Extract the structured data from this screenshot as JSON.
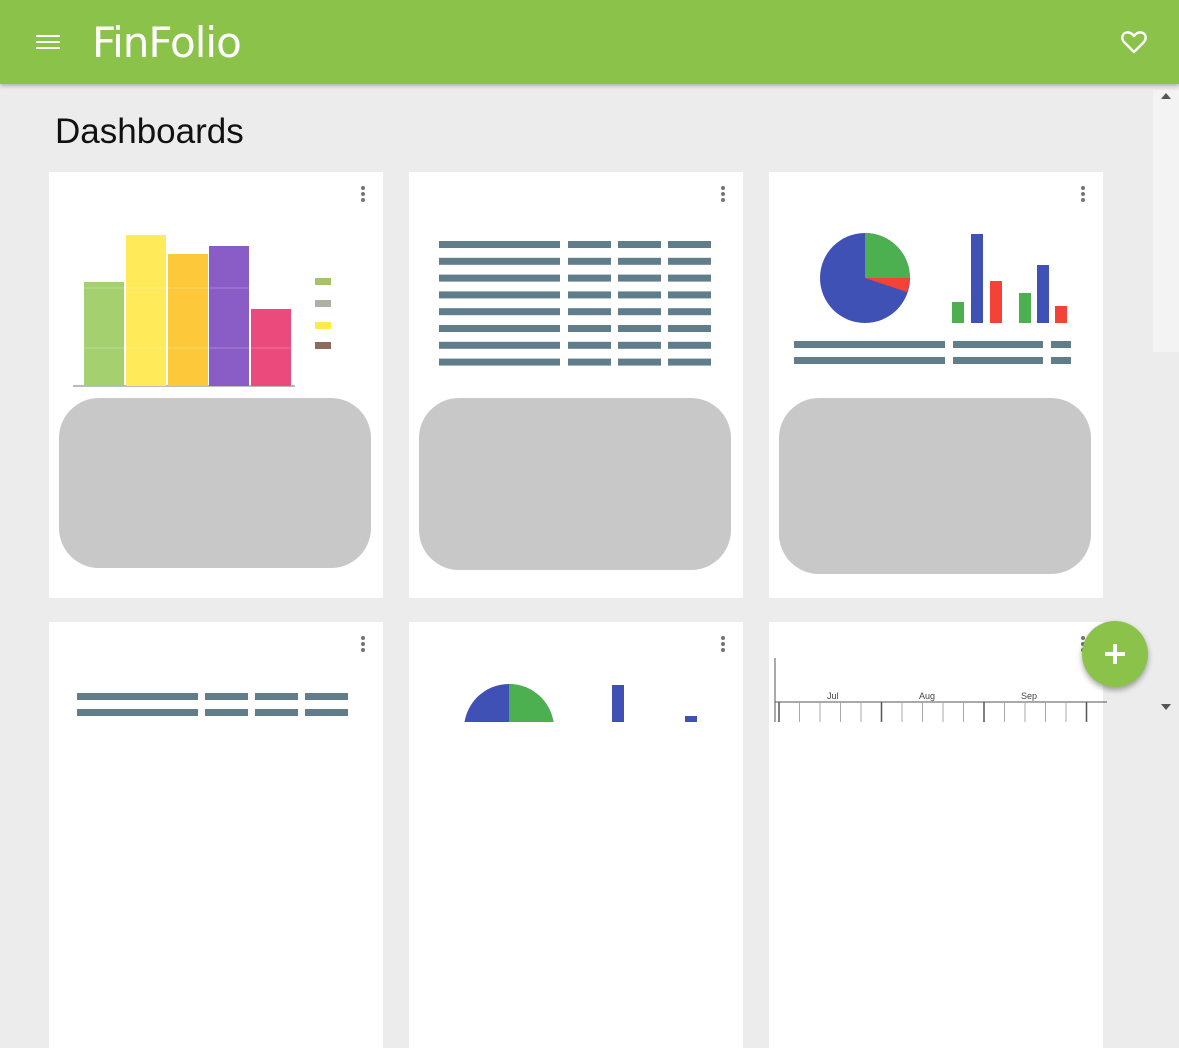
{
  "app": {
    "name": "FinFolio",
    "brand_color": "#8bc34a",
    "menu_icon": "menu-icon",
    "favorite_icon": "heart-outline-icon"
  },
  "page": {
    "title": "Dashboards"
  },
  "dashboards": [
    {
      "thumbnail": "bar-chart-thumbnail",
      "menu_icon": "more-vert-icon"
    },
    {
      "thumbnail": "table-thumbnail",
      "menu_icon": "more-vert-icon"
    },
    {
      "thumbnail": "pie-bar-table-thumbnail",
      "menu_icon": "more-vert-icon"
    },
    {
      "thumbnail": "table-thumbnail",
      "menu_icon": "more-vert-icon"
    },
    {
      "thumbnail": "pie-bar-thumbnail",
      "menu_icon": "more-vert-icon"
    },
    {
      "thumbnail": "timeline-thumbnail",
      "menu_icon": "more-vert-icon",
      "months": [
        "Jul",
        "Aug",
        "Sep"
      ]
    }
  ],
  "fab": {
    "icon": "plus-icon"
  }
}
